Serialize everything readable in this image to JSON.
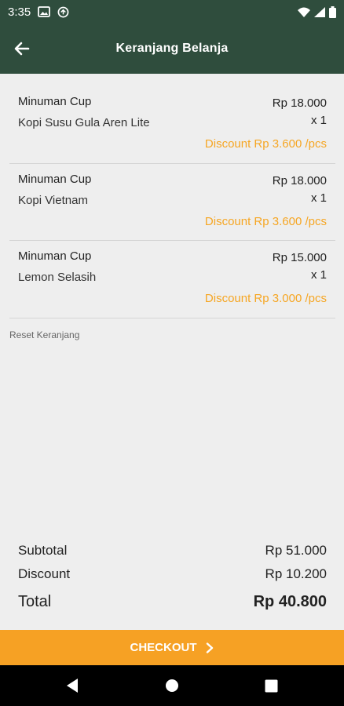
{
  "status_bar": {
    "time": "3:35"
  },
  "app_bar": {
    "title": "Keranjang Belanja"
  },
  "cart": {
    "items": [
      {
        "category": "Minuman Cup",
        "name": "Kopi Susu Gula Aren Lite",
        "price": "Rp 18.000",
        "qty": "x 1",
        "discount": "Discount Rp 3.600 /pcs"
      },
      {
        "category": "Minuman Cup",
        "name": "Kopi Vietnam",
        "price": "Rp 18.000",
        "qty": "x 1",
        "discount": "Discount Rp 3.600 /pcs"
      },
      {
        "category": "Minuman Cup",
        "name": "Lemon Selasih",
        "price": "Rp 15.000",
        "qty": "x 1",
        "discount": "Discount Rp 3.000 /pcs"
      }
    ],
    "reset_label": "Reset Keranjang"
  },
  "summary": {
    "subtotal_label": "Subtotal",
    "subtotal_value": "Rp 51.000",
    "discount_label": "Discount",
    "discount_value": "Rp 10.200",
    "total_label": "Total",
    "total_value": "Rp 40.800"
  },
  "checkout": {
    "label": "CHECKOUT"
  },
  "colors": {
    "header": "#2f4d3d",
    "accent": "#f6a124",
    "discount_text": "#f6a623"
  }
}
